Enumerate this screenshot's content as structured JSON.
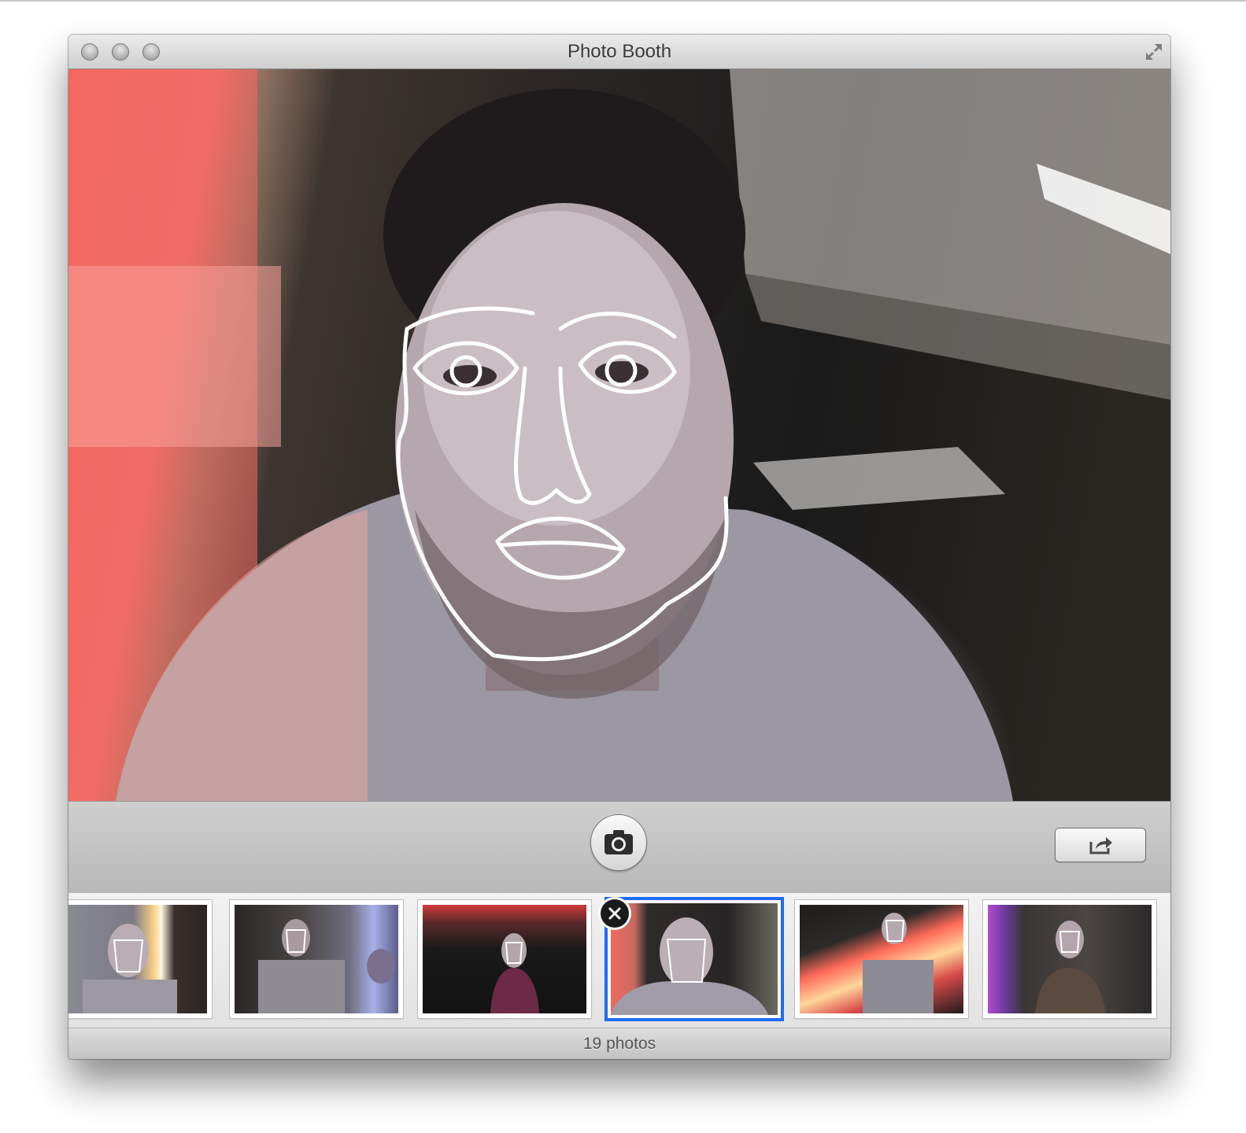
{
  "window": {
    "title": "Photo Booth"
  },
  "controls": {
    "shutter_icon": "camera-icon",
    "share_icon": "share-icon",
    "fullscreen_icon": "fullscreen-arrows-icon"
  },
  "filmstrip": {
    "photo_count_label": "19 photos",
    "selected_index": 3,
    "delete_icon": "close-icon",
    "selection_color": "#1e6cf5"
  },
  "colors": {
    "titlebar_top": "#ebebeb",
    "titlebar_bottom": "#cfcfcf",
    "control_bar": "#c4c4c4",
    "filmstrip_bg": "#ececec"
  }
}
